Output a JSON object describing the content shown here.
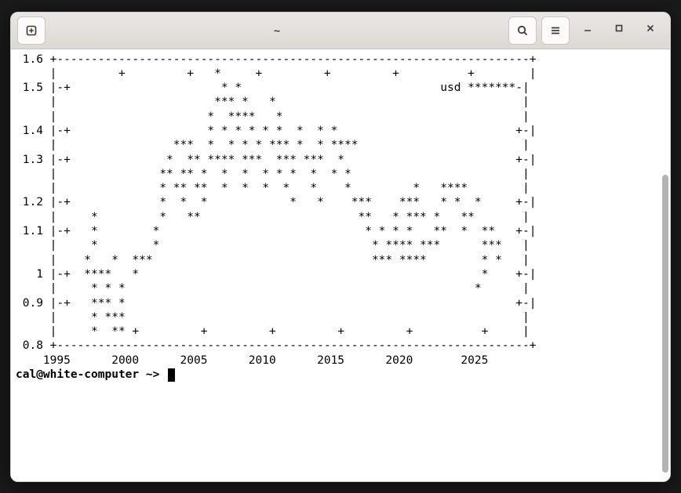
{
  "window": {
    "title": "~"
  },
  "prompt": {
    "user_host": "cal@white-computer",
    "path": "~",
    "symbol": ">"
  },
  "icons": {
    "new_tab": "new-tab-icon",
    "search": "search-icon",
    "menu": "hamburger-icon",
    "minimize": "minimize-icon",
    "maximize": "maximize-icon",
    "close": "close-icon"
  },
  "chart_data": {
    "type": "scatter",
    "title": "",
    "xlabel": "",
    "ylabel": "",
    "xlim": [
      1995,
      2025
    ],
    "ylim": [
      0.8,
      1.6
    ],
    "legend": "usd",
    "series": [
      {
        "name": "usd",
        "points": [
          {
            "x": 1999.0,
            "y": 1.16
          },
          {
            "x": 1999.2,
            "y": 1.12
          },
          {
            "x": 1999.4,
            "y": 1.07
          },
          {
            "x": 1999.6,
            "y": 1.06
          },
          {
            "x": 1999.8,
            "y": 1.04
          },
          {
            "x": 2000.0,
            "y": 1.01
          },
          {
            "x": 2000.2,
            "y": 0.97
          },
          {
            "x": 2000.4,
            "y": 0.93
          },
          {
            "x": 2000.6,
            "y": 0.95
          },
          {
            "x": 2000.8,
            "y": 0.89
          },
          {
            "x": 2001.0,
            "y": 0.87
          },
          {
            "x": 2001.2,
            "y": 0.92
          },
          {
            "x": 2001.4,
            "y": 0.89
          },
          {
            "x": 2001.6,
            "y": 0.87
          },
          {
            "x": 2001.8,
            "y": 0.91
          },
          {
            "x": 2002.0,
            "y": 0.89
          },
          {
            "x": 2002.2,
            "y": 0.88
          },
          {
            "x": 2002.4,
            "y": 0.93
          },
          {
            "x": 2002.6,
            "y": 0.98
          },
          {
            "x": 2002.8,
            "y": 1.01
          },
          {
            "x": 2003.0,
            "y": 1.06
          },
          {
            "x": 2003.2,
            "y": 1.08
          },
          {
            "x": 2003.4,
            "y": 1.16
          },
          {
            "x": 2003.6,
            "y": 1.12
          },
          {
            "x": 2003.8,
            "y": 1.17
          },
          {
            "x": 2004.0,
            "y": 1.26
          },
          {
            "x": 2004.2,
            "y": 1.23
          },
          {
            "x": 2004.4,
            "y": 1.2
          },
          {
            "x": 2004.6,
            "y": 1.22
          },
          {
            "x": 2004.8,
            "y": 1.27
          },
          {
            "x": 2005.0,
            "y": 1.35
          },
          {
            "x": 2005.2,
            "y": 1.3
          },
          {
            "x": 2005.4,
            "y": 1.26
          },
          {
            "x": 2005.6,
            "y": 1.21
          },
          {
            "x": 2005.8,
            "y": 1.2
          },
          {
            "x": 2006.0,
            "y": 1.18
          },
          {
            "x": 2006.2,
            "y": 1.21
          },
          {
            "x": 2006.4,
            "y": 1.27
          },
          {
            "x": 2006.6,
            "y": 1.27
          },
          {
            "x": 2006.8,
            "y": 1.28
          },
          {
            "x": 2007.0,
            "y": 1.32
          },
          {
            "x": 2007.2,
            "y": 1.33
          },
          {
            "x": 2007.4,
            "y": 1.35
          },
          {
            "x": 2007.6,
            "y": 1.36
          },
          {
            "x": 2007.8,
            "y": 1.42
          },
          {
            "x": 2008.0,
            "y": 1.47
          },
          {
            "x": 2008.2,
            "y": 1.52
          },
          {
            "x": 2008.4,
            "y": 1.56
          },
          {
            "x": 2008.6,
            "y": 1.5
          },
          {
            "x": 2008.8,
            "y": 1.39
          },
          {
            "x": 2009.0,
            "y": 1.3
          },
          {
            "x": 2009.2,
            "y": 1.31
          },
          {
            "x": 2009.4,
            "y": 1.37
          },
          {
            "x": 2009.6,
            "y": 1.43
          },
          {
            "x": 2009.8,
            "y": 1.48
          },
          {
            "x": 2010.0,
            "y": 1.44
          },
          {
            "x": 2010.2,
            "y": 1.36
          },
          {
            "x": 2010.4,
            "y": 1.25
          },
          {
            "x": 2010.6,
            "y": 1.29
          },
          {
            "x": 2010.8,
            "y": 1.33
          },
          {
            "x": 2011.0,
            "y": 1.34
          },
          {
            "x": 2011.2,
            "y": 1.4
          },
          {
            "x": 2011.4,
            "y": 1.44
          },
          {
            "x": 2011.6,
            "y": 1.42
          },
          {
            "x": 2011.8,
            "y": 1.36
          },
          {
            "x": 2012.0,
            "y": 1.3
          },
          {
            "x": 2012.2,
            "y": 1.32
          },
          {
            "x": 2012.4,
            "y": 1.26
          },
          {
            "x": 2012.6,
            "y": 1.25
          },
          {
            "x": 2012.8,
            "y": 1.29
          },
          {
            "x": 2013.0,
            "y": 1.32
          },
          {
            "x": 2013.2,
            "y": 1.3
          },
          {
            "x": 2013.4,
            "y": 1.31
          },
          {
            "x": 2013.6,
            "y": 1.33
          },
          {
            "x": 2013.8,
            "y": 1.36
          },
          {
            "x": 2014.0,
            "y": 1.37
          },
          {
            "x": 2014.2,
            "y": 1.38
          },
          {
            "x": 2014.4,
            "y": 1.36
          },
          {
            "x": 2014.6,
            "y": 1.33
          },
          {
            "x": 2014.8,
            "y": 1.26
          },
          {
            "x": 2015.0,
            "y": 1.2
          },
          {
            "x": 2015.2,
            "y": 1.09
          },
          {
            "x": 2015.4,
            "y": 1.11
          },
          {
            "x": 2015.6,
            "y": 1.11
          },
          {
            "x": 2015.8,
            "y": 1.09
          },
          {
            "x": 2016.0,
            "y": 1.09
          },
          {
            "x": 2016.2,
            "y": 1.12
          },
          {
            "x": 2016.4,
            "y": 1.13
          },
          {
            "x": 2016.6,
            "y": 1.12
          },
          {
            "x": 2016.8,
            "y": 1.1
          },
          {
            "x": 2017.0,
            "y": 1.06
          },
          {
            "x": 2017.2,
            "y": 1.07
          },
          {
            "x": 2017.4,
            "y": 1.12
          },
          {
            "x": 2017.6,
            "y": 1.18
          },
          {
            "x": 2017.8,
            "y": 1.18
          },
          {
            "x": 2018.0,
            "y": 1.22
          },
          {
            "x": 2018.2,
            "y": 1.23
          },
          {
            "x": 2018.4,
            "y": 1.18
          },
          {
            "x": 2018.6,
            "y": 1.16
          },
          {
            "x": 2018.8,
            "y": 1.14
          },
          {
            "x": 2019.0,
            "y": 1.14
          },
          {
            "x": 2019.2,
            "y": 1.13
          },
          {
            "x": 2019.4,
            "y": 1.12
          },
          {
            "x": 2019.6,
            "y": 1.11
          },
          {
            "x": 2019.8,
            "y": 1.11
          },
          {
            "x": 2020.0,
            "y": 1.11
          },
          {
            "x": 2020.2,
            "y": 1.09
          },
          {
            "x": 2020.4,
            "y": 1.12
          },
          {
            "x": 2020.6,
            "y": 1.18
          },
          {
            "x": 2020.8,
            "y": 1.19
          },
          {
            "x": 2021.0,
            "y": 1.22
          },
          {
            "x": 2021.2,
            "y": 1.2
          },
          {
            "x": 2021.4,
            "y": 1.21
          },
          {
            "x": 2021.6,
            "y": 1.18
          },
          {
            "x": 2021.8,
            "y": 1.15
          },
          {
            "x": 2022.0,
            "y": 1.13
          },
          {
            "x": 2022.2,
            "y": 1.1
          },
          {
            "x": 2022.4,
            "y": 1.06
          },
          {
            "x": 2022.6,
            "y": 1.01
          },
          {
            "x": 2022.8,
            "y": 0.98
          },
          {
            "x": 2023.0,
            "y": 1.07
          },
          {
            "x": 2023.2,
            "y": 1.08
          },
          {
            "x": 2023.4,
            "y": 1.09
          },
          {
            "x": 2023.6,
            "y": 1.09
          },
          {
            "x": 2023.8,
            "y": 1.06
          },
          {
            "x": 2024.0,
            "y": 1.09
          }
        ]
      }
    ],
    "y_ticks": [
      0.8,
      0.9,
      1.0,
      1.1,
      1.2,
      1.3,
      1.4,
      1.5,
      1.6
    ],
    "x_ticks": [
      1995,
      2000,
      2005,
      2010,
      2015,
      2020,
      2025
    ]
  },
  "ascii_plot": " 1.6 +---------------------------------------------------------------------+\n     |         +         +   *     +         +         +          +        |\n 1.5 |-+                      * *                             usd *******-|\n     |                       *** *   *                                    |\n     |                      *  ****   *                                   |\n 1.4 |-+                    * * * * * *  *  * *                          +-|\n     |                 ***  *  * * * *** *  * ****                        |\n 1.3 |-+              *  ** **** ***  *** ***  *                         +-|\n     |               ** ** *  *  *  * * *  *  * *                         |\n     |               * ** **  *  *  *  *   *    *         *   ****        |\n 1.2 |-+             *  *  *            *   *    ***    ***   * *  *     +-|\n     |     *         *   **                       **   * *** *   **       |\n 1.1 |-+   *        *                              * * * *   **  *  **   +-|\n     |     *        *                               * **** ***      ***   |\n     |    *   *  ***                                *** ****        * *   |\n   1 |-+  ****   *                                                  *    +-|\n     |     * * *                                                   *      |\n 0.9 |-+   *** *                                                         +-|\n     |     * ***                                                          |\n     |     *  ** +         +         +         +         +          +     |\n 0.8 +---------------------------------------------------------------------+\n    1995      2000      2005      2010      2015      2020       2025\n"
}
